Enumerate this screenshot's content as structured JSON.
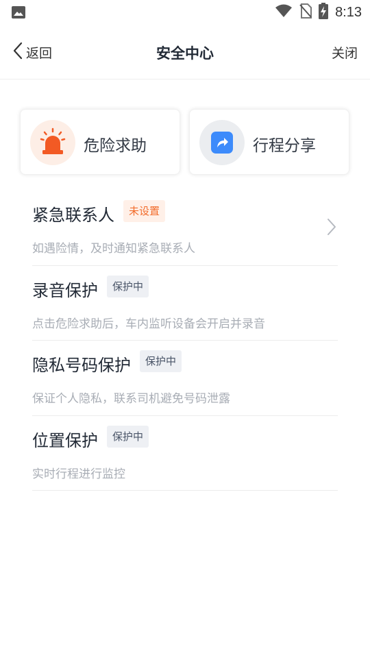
{
  "status": {
    "time": "8:13"
  },
  "nav": {
    "back_label": "返回",
    "title": "安全中心",
    "close_label": "关闭"
  },
  "actions": [
    {
      "label": "危险求助",
      "icon": "alarm-siren-icon",
      "color": "#f25a24"
    },
    {
      "label": "行程分享",
      "icon": "share-arrow-icon",
      "color": "#3d8bfb"
    }
  ],
  "items": [
    {
      "title": "紧急联系人",
      "badge": "未设置",
      "badge_type": "warn",
      "desc": "如遇险情，及时通知紧急联系人"
    },
    {
      "title": "录音保护",
      "badge": "保护中",
      "badge_type": "ok",
      "desc": "点击危险求助后，车内监听设备会开启并录音"
    },
    {
      "title": "隐私号码保护",
      "badge": "保护中",
      "badge_type": "ok",
      "desc": "保证个人隐私，联系司机避免号码泄露"
    },
    {
      "title": "位置保护",
      "badge": "保护中",
      "badge_type": "ok",
      "desc": "实时行程进行监控"
    }
  ]
}
